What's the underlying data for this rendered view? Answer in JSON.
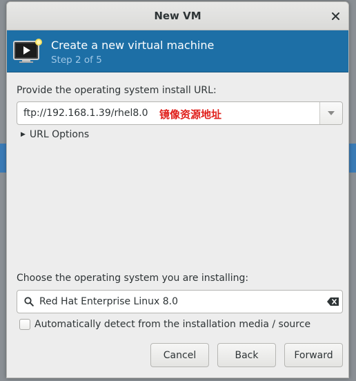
{
  "window": {
    "title": "New VM"
  },
  "banner": {
    "title": "Create a new virtual machine",
    "step": "Step 2 of 5",
    "icon": "monitor-play-icon"
  },
  "install_url": {
    "label": "Provide the operating system install URL:",
    "value": "ftp://192.168.1.39/rhel8.0",
    "annotation": "镜像资源地址",
    "annotation_color": "#e0201b"
  },
  "url_options": {
    "label": "URL Options",
    "expanded": false
  },
  "os_select": {
    "label": "Choose the operating system you are installing:",
    "value": "Red Hat Enterprise Linux 8.0"
  },
  "auto_detect": {
    "label": "Automatically detect from the installation media / source",
    "checked": false
  },
  "buttons": {
    "cancel": "Cancel",
    "back": "Back",
    "forward": "Forward"
  },
  "colors": {
    "banner_bg": "#1d6fa6",
    "banner_step": "#9fc7e6"
  }
}
